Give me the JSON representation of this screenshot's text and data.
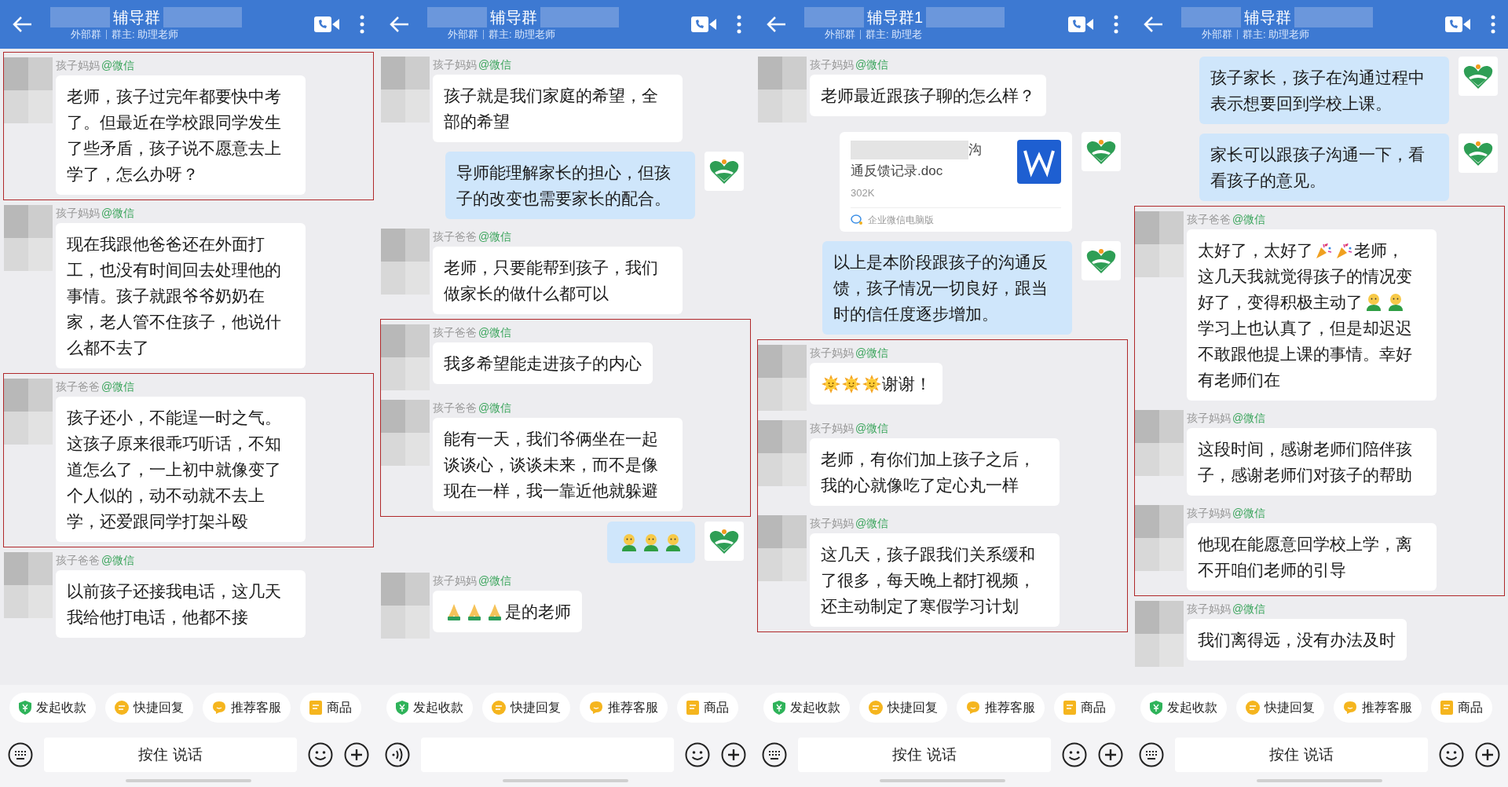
{
  "panels": [
    {
      "header": {
        "title": "辅导群",
        "group_type": "外部群",
        "owner": "群主: 助理老师"
      },
      "messages": [
        {
          "kind": "incoming",
          "sender": "孩子妈妈",
          "source": "@微信",
          "text": "老师，孩子过完年都要快中考了。但最近在学校跟同学发生了些矛盾，孩子说不愿意去上学了，怎么办呀？",
          "highlighted": true
        },
        {
          "kind": "incoming",
          "sender": "孩子妈妈",
          "source": "@微信",
          "text": "现在我跟他爸爸还在外面打工，也没有时间回去处理他的事情。孩子就跟爷爷奶奶在家，老人管不住孩子，他说什么都不去了",
          "highlighted": false
        },
        {
          "kind": "incoming",
          "sender": "孩子爸爸",
          "source": "@微信",
          "text": "孩子还小，不能逞一时之气。这孩子原来很乖巧听话，不知道怎么了，一上初中就像变了个人似的，动不动就不去上学，还爱跟同学打架斗殴",
          "highlighted": true
        },
        {
          "kind": "incoming",
          "sender": "孩子爸爸",
          "source": "@微信",
          "text": "以前孩子还接我电话，这几天我给他打电话，他都不接",
          "highlighted": false
        }
      ],
      "quick_actions": [
        {
          "kind": "payment",
          "label": "发起收款"
        },
        {
          "kind": "reply",
          "label": "快捷回复"
        },
        {
          "kind": "service",
          "label": "推荐客服"
        },
        {
          "kind": "product",
          "label": "商品"
        }
      ],
      "input": {
        "kind": "hold_to_talk",
        "label": "按住 说话"
      }
    },
    {
      "header": {
        "title": "辅导群",
        "group_type": "外部群",
        "owner": "群主: 助理老师"
      },
      "messages": [
        {
          "kind": "incoming",
          "sender": "孩子妈妈",
          "source": "@微信",
          "text": "孩子就是我们家庭的希望，全部的希望",
          "highlighted": false
        },
        {
          "kind": "outgoing",
          "text": "导师能理解家长的担心，但孩子的改变也需要家长的配合。",
          "highlighted": false
        },
        {
          "kind": "incoming",
          "sender": "孩子爸爸",
          "source": "@微信",
          "text": "老师，只要能帮到孩子，我们做家长的做什么都可以",
          "highlighted": false
        },
        {
          "kind": "incoming",
          "sender": "孩子爸爸",
          "source": "@微信",
          "text": "我多希望能走进孩子的内心",
          "highlighted": true
        },
        {
          "kind": "incoming",
          "sender": "孩子爸爸",
          "source": "@微信",
          "text": "能有一天，我们爷俩坐在一起谈谈心，谈谈未来，而不是像现在一样，我一靠近他就躲避",
          "highlighted": true
        },
        {
          "kind": "outgoing",
          "segments": [
            {
              "kind": "figure"
            },
            {
              "kind": "figure"
            },
            {
              "kind": "figure"
            }
          ],
          "highlighted": false
        },
        {
          "kind": "incoming",
          "sender": "孩子妈妈",
          "source": "@微信",
          "segments": [
            {
              "kind": "pray"
            },
            {
              "kind": "pray"
            },
            {
              "kind": "pray"
            },
            {
              "kind": "text",
              "text": "是的老师"
            }
          ],
          "highlighted": false
        }
      ],
      "quick_actions": [
        {
          "kind": "payment",
          "label": "发起收款"
        },
        {
          "kind": "reply",
          "label": "快捷回复"
        },
        {
          "kind": "service",
          "label": "推荐客服"
        },
        {
          "kind": "product",
          "label": "商品"
        }
      ],
      "input": {
        "kind": "text_field"
      }
    },
    {
      "header": {
        "title": "辅导群1",
        "group_type": "外部群",
        "owner": "群主: 助理老"
      },
      "messages": [
        {
          "kind": "incoming",
          "sender": "孩子妈妈",
          "source": "@微信",
          "text": "老师最近跟孩子聊的怎么样？",
          "highlighted": false
        },
        {
          "kind": "file",
          "name_end": "沟",
          "name": "通反馈记录.doc",
          "size": "302K",
          "app": "企业微信电脑版",
          "highlighted": false
        },
        {
          "kind": "outgoing",
          "text": "以上是本阶段跟孩子的沟通反馈，孩子情况一切良好，跟当时的信任度逐步增加。",
          "highlighted": false
        },
        {
          "kind": "incoming",
          "sender": "孩子妈妈",
          "source": "@微信",
          "segments": [
            {
              "kind": "sun"
            },
            {
              "kind": "sun"
            },
            {
              "kind": "sun"
            },
            {
              "kind": "text",
              "text": "谢谢！"
            }
          ],
          "highlighted": true
        },
        {
          "kind": "incoming",
          "sender": "孩子妈妈",
          "source": "@微信",
          "text": "老师，有你们加上孩子之后，我的心就像吃了定心丸一样",
          "highlighted": true
        },
        {
          "kind": "incoming",
          "sender": "孩子妈妈",
          "source": "@微信",
          "text": "这几天，孩子跟我们关系缓和了很多，每天晚上都打视频，还主动制定了寒假学习计划",
          "highlighted": true
        }
      ],
      "quick_actions": [
        {
          "kind": "payment",
          "label": "发起收款"
        },
        {
          "kind": "reply",
          "label": "快捷回复"
        },
        {
          "kind": "service",
          "label": "推荐客服"
        },
        {
          "kind": "product",
          "label": "商品"
        }
      ],
      "input": {
        "kind": "hold_to_talk",
        "label": "按住 说话"
      }
    },
    {
      "header": {
        "title": "辅导群",
        "group_type": "外部群",
        "owner": "群主: 助理老师"
      },
      "messages": [
        {
          "kind": "outgoing",
          "text": "孩子家长，孩子在沟通过程中表示想要回到学校上课。",
          "highlighted": false
        },
        {
          "kind": "outgoing",
          "text": "家长可以跟孩子沟通一下，看看孩子的意见。",
          "highlighted": false
        },
        {
          "kind": "incoming",
          "sender": "孩子爸爸",
          "source": "@微信",
          "segments": [
            {
              "kind": "text",
              "text": "太好了，太好了"
            },
            {
              "kind": "party"
            },
            {
              "kind": "party"
            },
            {
              "kind": "text",
              "text": "老师，"
            },
            {
              "kind": "break"
            },
            {
              "kind": "text",
              "text": "这几天我就觉得孩子的情况变"
            },
            {
              "kind": "break"
            },
            {
              "kind": "text",
              "text": "好了，变得积极主动了"
            },
            {
              "kind": "figure"
            },
            {
              "kind": "figure"
            },
            {
              "kind": "break"
            },
            {
              "kind": "text",
              "text": "学习上也认真了，但是却迟迟不敢跟他提上课的事情。幸好有老师们在"
            }
          ],
          "highlighted": true
        },
        {
          "kind": "incoming",
          "sender": "孩子妈妈",
          "source": "@微信",
          "text": "这段时间，感谢老师们陪伴孩子，感谢老师们对孩子的帮助",
          "highlighted": true
        },
        {
          "kind": "incoming",
          "sender": "孩子妈妈",
          "source": "@微信",
          "text": "他现在能愿意回学校上学，离不开咱们老师的引导",
          "highlighted": true
        },
        {
          "kind": "incoming",
          "sender": "孩子妈妈",
          "source": "@微信",
          "text": "我们离得远，没有办法及时",
          "highlighted": false
        }
      ],
      "quick_actions": [
        {
          "kind": "payment",
          "label": "发起收款"
        },
        {
          "kind": "reply",
          "label": "快捷回复"
        },
        {
          "kind": "service",
          "label": "推荐客服"
        },
        {
          "kind": "product",
          "label": "商品"
        }
      ],
      "input": {
        "kind": "hold_to_talk",
        "label": "按住 说话"
      }
    }
  ]
}
